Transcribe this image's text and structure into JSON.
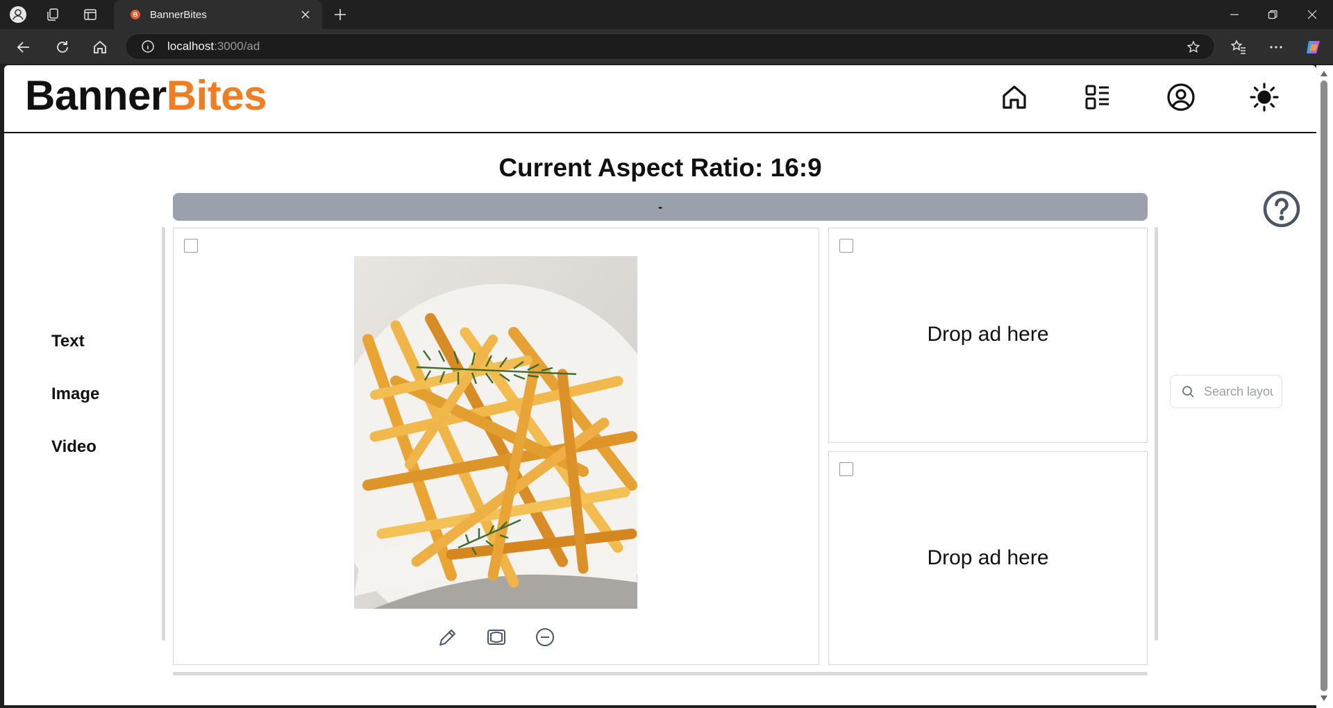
{
  "browser": {
    "tab_title": "BannerBites",
    "tab_favicon_letter": "B",
    "url_host": "localhost",
    "url_path": ":3000/ad"
  },
  "header": {
    "logo_part1": "Banner",
    "logo_part2": "Bites",
    "logo_accent_color": "#f07d21",
    "icons": [
      "home-icon",
      "layout-list-icon",
      "user-circle-icon",
      "sun-icon"
    ]
  },
  "page": {
    "aspect_title": "Current Aspect Ratio: 16:9",
    "ratio_bar_label": "-"
  },
  "sidebar": {
    "items": [
      {
        "label": "Text"
      },
      {
        "label": "Image"
      },
      {
        "label": "Video"
      }
    ]
  },
  "slots": {
    "main": {
      "content": "french-fries-image"
    },
    "top_right": {
      "drop_label": "Drop ad here"
    },
    "bottom_right": {
      "drop_label": "Drop ad here"
    }
  },
  "search": {
    "placeholder": "Search layouts"
  }
}
